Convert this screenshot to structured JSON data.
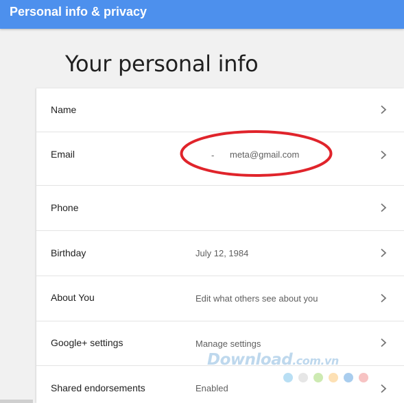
{
  "header": {
    "title": "Personal info & privacy",
    "color": "#4d90ed"
  },
  "main": {
    "page_title": "Your personal info",
    "rows": [
      {
        "label": "Name",
        "value": ""
      },
      {
        "label": "Email",
        "value": "meta@gmail.com",
        "prefix": "-"
      },
      {
        "label": "Phone",
        "value": ""
      },
      {
        "label": "Birthday",
        "value": "July 12, 1984"
      },
      {
        "label": "About You",
        "value": "Edit what others see about you"
      },
      {
        "label": "Google+ settings",
        "value": "Manage settings"
      },
      {
        "label": "Shared endorsements",
        "value": "Enabled"
      }
    ],
    "row_icon": "chevron-right-icon",
    "highlight_color": "#e0242b"
  },
  "watermark": {
    "text": "Download",
    "suffix": ".com.vn",
    "dot_colors": [
      "#b9dff4",
      "#e6e6e6",
      "#cdeab2",
      "#fde0b4",
      "#a9cdee",
      "#f7c3c3"
    ]
  }
}
